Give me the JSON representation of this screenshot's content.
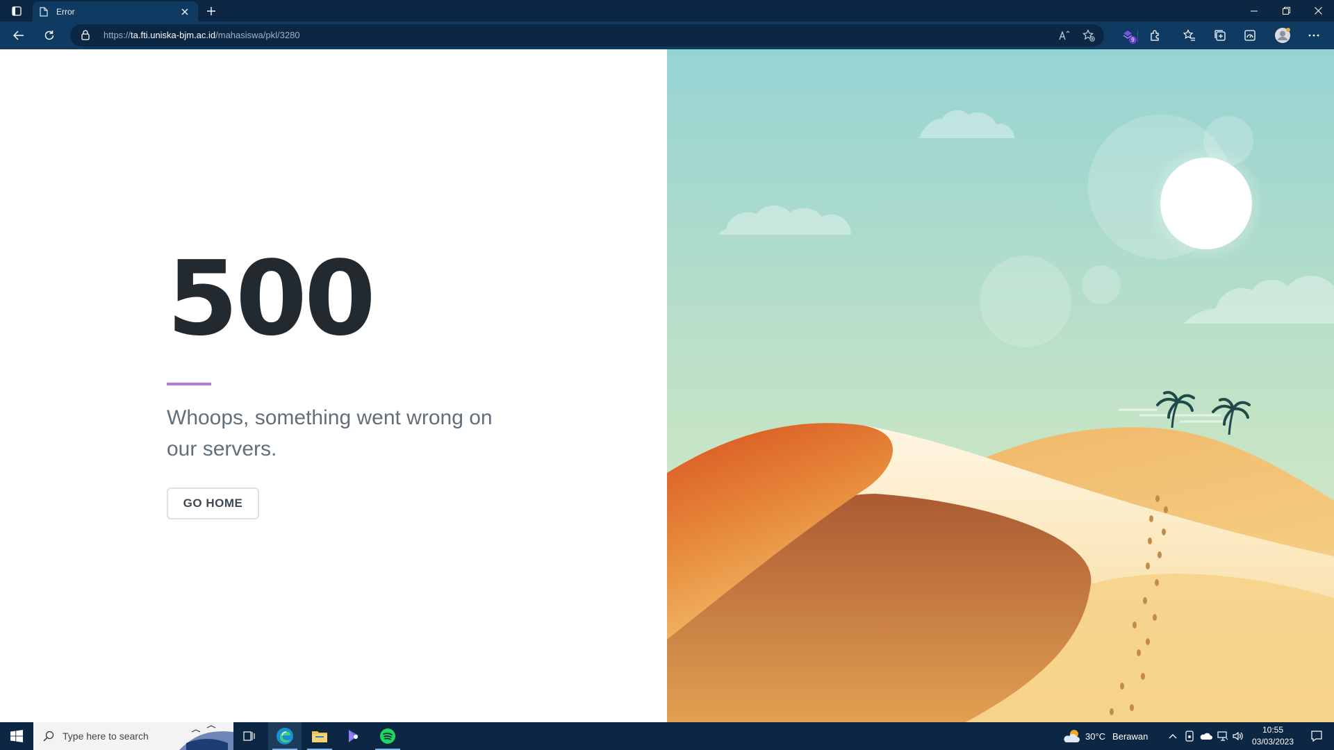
{
  "browser": {
    "tab_title": "Error",
    "url_prefix": "https://",
    "url_host": "ta.fti.uniska-bjm.ac.id",
    "url_path": "/mahasiswa/pkl/3280",
    "extension_badge": "9"
  },
  "page": {
    "error_code": "500",
    "message": "Whoops, something went wrong on our servers.",
    "button_label": "GO HOME",
    "accent_color": "#b27ad8"
  },
  "taskbar": {
    "search_placeholder": "Type here to search",
    "weather_temp": "30°C",
    "weather_desc": "Berawan",
    "time": "10:55",
    "date": "03/03/2023"
  }
}
